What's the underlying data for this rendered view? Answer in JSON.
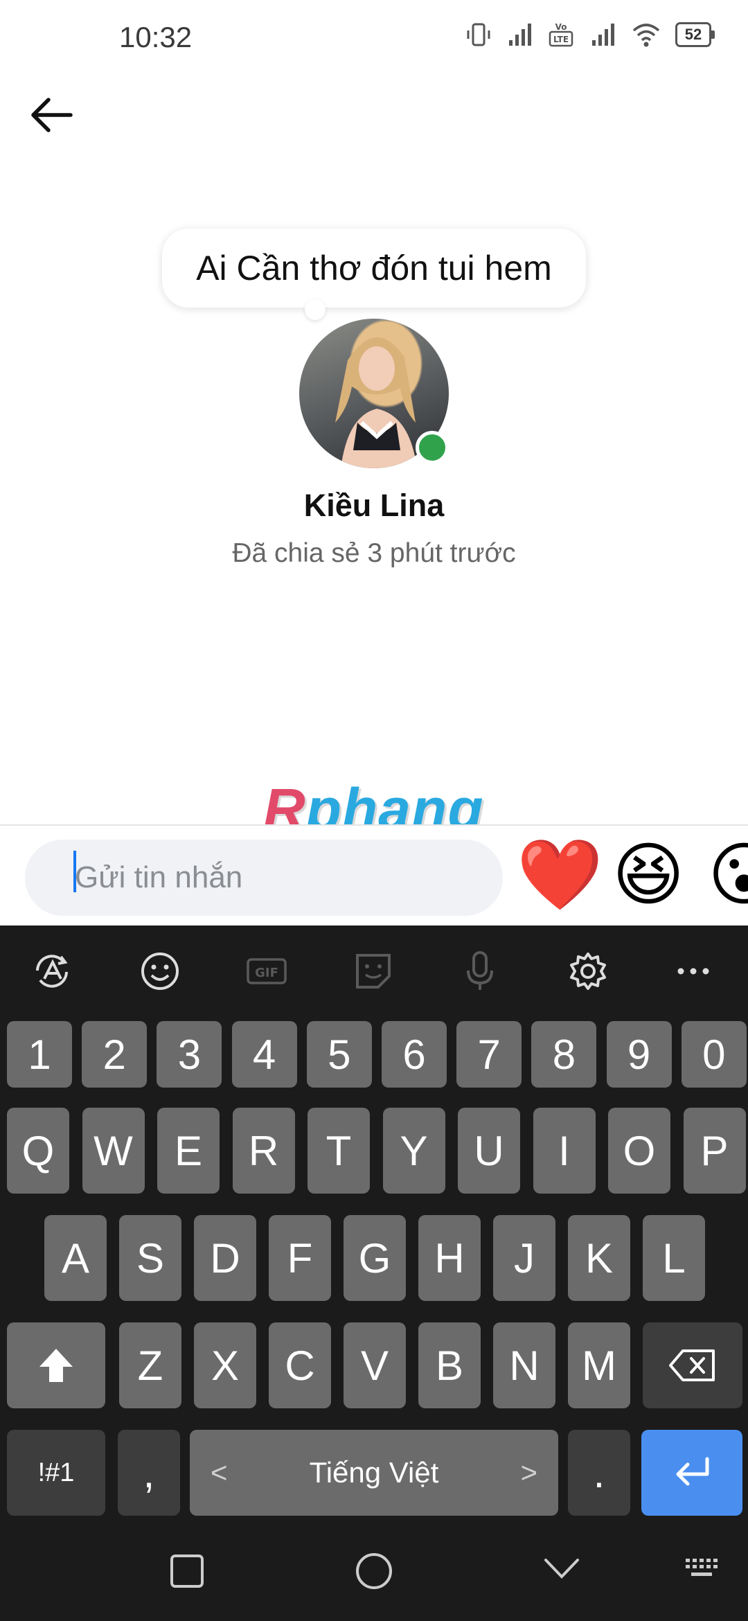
{
  "status_bar": {
    "time": "10:32",
    "battery": "52",
    "network_label": "Vo LTE"
  },
  "note": {
    "text": "Ai Cần thơ đón tui hem"
  },
  "profile": {
    "name": "Kiều Lina",
    "shared_time": "Đã chia sẻ 3 phút trước",
    "online": true
  },
  "watermark": {
    "r": "R",
    "rest": "phang"
  },
  "composer": {
    "placeholder": "Gửi tin nhắn",
    "quick_reactions": [
      "❤️",
      "😆",
      "😮"
    ]
  },
  "keyboard": {
    "number_row": [
      "1",
      "2",
      "3",
      "4",
      "5",
      "6",
      "7",
      "8",
      "9",
      "0"
    ],
    "row1": [
      "Q",
      "W",
      "E",
      "R",
      "T",
      "Y",
      "U",
      "I",
      "O",
      "P"
    ],
    "row2": [
      "A",
      "S",
      "D",
      "F",
      "G",
      "H",
      "J",
      "K",
      "L"
    ],
    "row3": [
      "Z",
      "X",
      "C",
      "V",
      "B",
      "N",
      "M"
    ],
    "symbols_label": "!#1",
    "comma_label": ",",
    "space_label": "Tiếng Việt",
    "period_label": ".",
    "toolbar_gif_label": "GIF"
  },
  "colors": {
    "online": "#31a24c",
    "accent": "#1877f2",
    "enter_key": "#4a8ff0",
    "keyboard_bg": "#1b1b1b"
  }
}
